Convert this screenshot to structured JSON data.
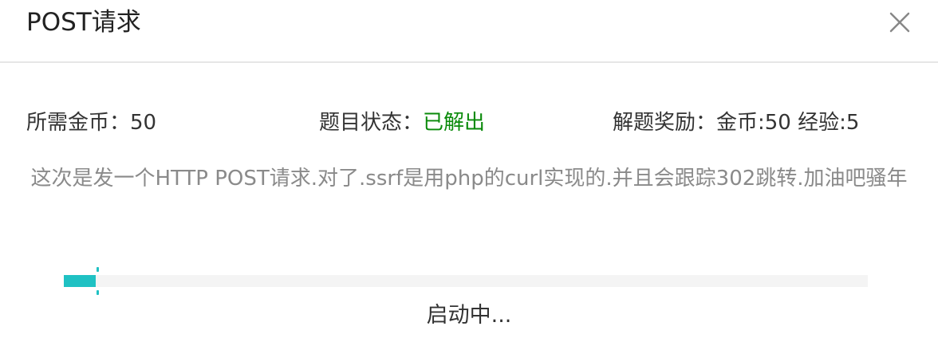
{
  "dialog": {
    "title": "POST请求",
    "close_icon": "close-icon"
  },
  "info": {
    "cost": "所需金币：50",
    "status_label": "题目状态：",
    "status_value": "已解出",
    "status_color": "#0a8a0a",
    "reward": "解题奖励：金币:50 经验:5"
  },
  "description": "这次是发一个HTTP POST请求.对了.ssrf是用php的curl实现的.并且会跟踪302跳转.加油吧骚年",
  "progress": {
    "fraction": 0.04,
    "status_text": "启动中...",
    "accent_color": "#1fc1c3"
  }
}
